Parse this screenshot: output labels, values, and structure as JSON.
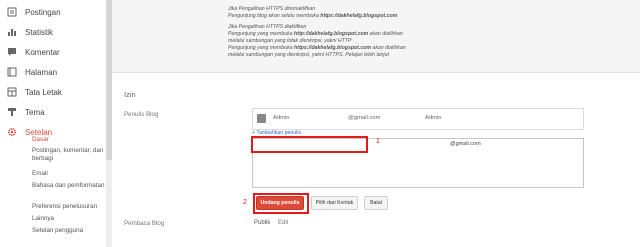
{
  "sidebar": {
    "items": [
      {
        "label": "Postingan",
        "icon": "posts-icon"
      },
      {
        "label": "Statistik",
        "icon": "stats-icon"
      },
      {
        "label": "Komentar",
        "icon": "comments-icon"
      },
      {
        "label": "Halaman",
        "icon": "pages-icon"
      },
      {
        "label": "Tata Letak",
        "icon": "layout-icon"
      },
      {
        "label": "Tema",
        "icon": "theme-icon"
      },
      {
        "label": "Setelan",
        "icon": "settings-gear-icon"
      }
    ],
    "subitems": [
      "Dasar",
      "Postingan, komentar, dan berbagi",
      "Email",
      "Bahasa dan pemformatan",
      "Preferensi penelusuran",
      "Lainnya",
      "Setelan pengguna"
    ]
  },
  "https_notes": {
    "off_title": "Jika Pengalihan HTTPS dinonaktifkan",
    "off_line1_pre": "Pengunjung blog akan selalu membuka ",
    "off_line1_url": "https://dakhelafg.blogspot.com",
    "on_title": "Jika Pengalihan HTTPS diaktifkan",
    "on_line1_pre": "Pengunjung yang membuka ",
    "on_line1_url": "http://dakhelafg.blogspot.com",
    "on_line1_post": " akan dialihkan",
    "on_line2": "melalui sambungan yang tidak dienkripsi, yakni HTTP",
    "on_line3_pre": "Pengunjung yang membuka ",
    "on_line3_url": "https://dakhelafg.blogspot.com",
    "on_line3_post": " akan dialihkan",
    "on_line4": "melalui sambungan yang dienkripsi, yakni HTTPS. Pelajari lebih lanjut"
  },
  "permissions": {
    "section_title": "Izin",
    "authors_label": "Penulis Blog",
    "author_name": "Admin",
    "author_email": "@gmail.com",
    "author_role": "Admin",
    "add_authors": "+ Tambahkan penulis",
    "invite_value": "@gmail.com",
    "invite_button": "Undang penulis",
    "contacts_button": "Pilih dari Kontak",
    "cancel_button": "Batal",
    "readers_label": "Pembaca Blog",
    "readers_value": "Publik",
    "readers_edit": "Edit"
  },
  "annotations": {
    "one": "1",
    "two": "2"
  },
  "colors": {
    "accent": "#dd4b39",
    "annotation": "#e31b1b",
    "link": "#3366cc"
  }
}
